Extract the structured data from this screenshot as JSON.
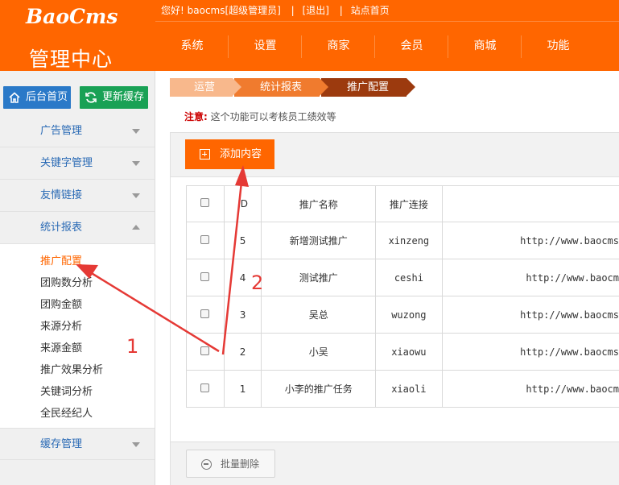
{
  "header": {
    "brand": "BaoCms",
    "title": "管理中心",
    "topbar": {
      "greeting": "您好! baocms[超级管理员]",
      "sep1": "|",
      "logout": "[退出]",
      "sep2": "|",
      "site_home": "站点首页"
    },
    "nav": [
      "系统",
      "设置",
      "商家",
      "会员",
      "商城",
      "功能"
    ]
  },
  "sidebar": {
    "home_button": "后台首页",
    "refresh_button": "更新缓存",
    "groups": [
      {
        "label": "广告管理"
      },
      {
        "label": "关键字管理"
      },
      {
        "label": "友情链接"
      },
      {
        "label": "统计报表"
      }
    ],
    "submenu": [
      "推广配置",
      "团购数分析",
      "团购金额",
      "来源分析",
      "来源金额",
      "推广效果分析",
      "关键词分析",
      "全民经纪人"
    ],
    "bottom_group": {
      "label": "缓存管理"
    }
  },
  "breadcrumb": [
    "运营",
    "统计报表",
    "推广配置"
  ],
  "notice": {
    "label": "注意:",
    "text": "这个功能可以考核员工绩效等"
  },
  "actions": {
    "add": "添加内容",
    "bulk_delete": "批量删除"
  },
  "table": {
    "headers": [
      "",
      "ID",
      "推广名称",
      "推广连接",
      ""
    ],
    "rows": [
      {
        "id": "5",
        "name": "新增测试推广",
        "link": "xinzeng",
        "url": "http://www.baocms"
      },
      {
        "id": "4",
        "name": "测试推广",
        "link": "ceshi",
        "url": "http://www.baocm"
      },
      {
        "id": "3",
        "name": "吴总",
        "link": "wuzong",
        "url": "http://www.baocms"
      },
      {
        "id": "2",
        "name": "小吴",
        "link": "xiaowu",
        "url": "http://www.baocms"
      },
      {
        "id": "1",
        "name": "小李的推广任务",
        "link": "xiaoli",
        "url": "http://www.baocm"
      }
    ]
  },
  "annotations": {
    "one": "1",
    "two": "2"
  },
  "colors": {
    "brand": "#ff6600",
    "link": "#2a6ab5",
    "annotation": "#e53935"
  },
  "icons": [
    "home-icon",
    "refresh-icon",
    "plus-icon",
    "minus-icon",
    "caret-down-icon",
    "caret-up-icon"
  ]
}
